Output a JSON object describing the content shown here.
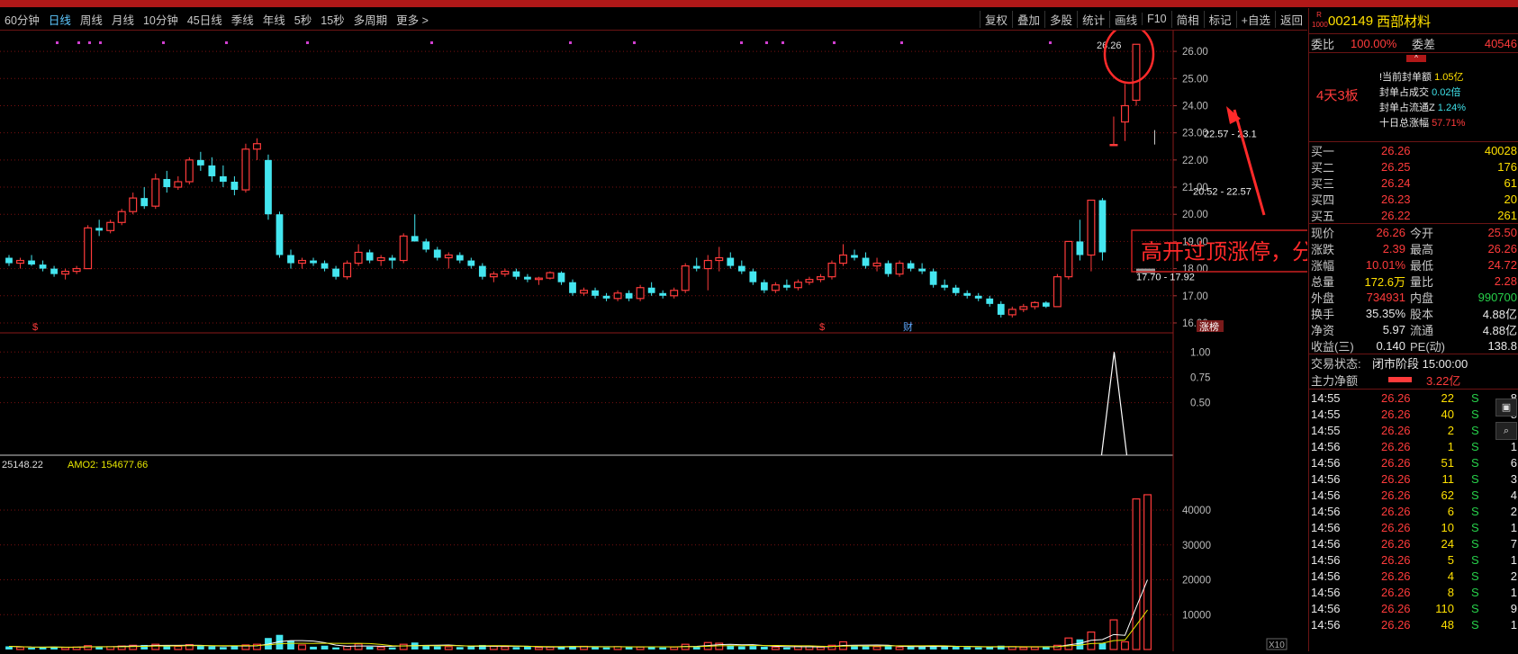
{
  "toolbar": {
    "periods": [
      "60分钟",
      "日线",
      "周线",
      "月线",
      "10分钟",
      "45日线",
      "季线",
      "年线",
      "5秒",
      "15秒",
      "多周期",
      "更多 >"
    ],
    "active_period": "日线",
    "buttons": [
      "复权",
      "叠加",
      "多股",
      "统计",
      "画线",
      "F10",
      "简相",
      "标记",
      "+自选",
      "返回"
    ]
  },
  "colors": {
    "up": "#ff3b3b",
    "down": "#44e6f0",
    "ma1": "#ffffff",
    "ma2": "#e6e600",
    "grid": "#7a1010",
    "accent": "#ffe000"
  },
  "chart": {
    "price_axis": [
      "26.00",
      "25.00",
      "24.00",
      "23.00",
      "22.00",
      "21.00",
      "20.00",
      "19.00",
      "18.00",
      "17.00",
      "16.00"
    ],
    "top_price_label": "26.26",
    "zone_labels": [
      "22.57 - 23.1",
      "20.52 - 22.57",
      "17.70 - 17.92"
    ],
    "annotation": "高开过顶涨停，分歧转一致",
    "event_marks": [
      "$",
      "$",
      "财",
      "涨榜"
    ],
    "indicator_axis": [
      "1.00",
      "0.75",
      "0.50"
    ],
    "vol_legend_prefix": "25148.22",
    "vol_legend_amo2": "AMO2: 154677.66",
    "vol_axis": [
      "40000",
      "30000",
      "20000",
      "10000"
    ],
    "vol_unit": "X10"
  },
  "chart_data": {
    "type": "candlestick",
    "ohlc": [
      [
        18.4,
        18.5,
        18.1,
        18.2
      ],
      [
        18.2,
        18.4,
        18.0,
        18.3
      ],
      [
        18.3,
        18.5,
        18.1,
        18.15
      ],
      [
        18.15,
        18.3,
        17.9,
        18.0
      ],
      [
        18.0,
        18.1,
        17.7,
        17.8
      ],
      [
        17.8,
        18.0,
        17.6,
        17.9
      ],
      [
        17.9,
        18.1,
        17.8,
        18.0
      ],
      [
        18.0,
        19.6,
        18.0,
        19.5
      ],
      [
        19.5,
        19.8,
        19.2,
        19.4
      ],
      [
        19.4,
        19.8,
        19.3,
        19.7
      ],
      [
        19.7,
        20.2,
        19.6,
        20.1
      ],
      [
        20.1,
        20.8,
        20.0,
        20.6
      ],
      [
        20.6,
        21.0,
        20.2,
        20.3
      ],
      [
        20.3,
        21.5,
        20.2,
        21.3
      ],
      [
        21.3,
        21.6,
        20.8,
        21.0
      ],
      [
        21.0,
        21.4,
        20.9,
        21.2
      ],
      [
        21.2,
        22.1,
        21.1,
        22.0
      ],
      [
        22.0,
        22.3,
        21.6,
        21.8
      ],
      [
        21.8,
        22.1,
        21.2,
        21.4
      ],
      [
        21.4,
        21.8,
        21.0,
        21.2
      ],
      [
        21.2,
        21.4,
        20.7,
        20.9
      ],
      [
        20.9,
        22.6,
        20.8,
        22.4
      ],
      [
        22.4,
        22.8,
        22.0,
        22.6
      ],
      [
        22.0,
        22.2,
        19.8,
        20.0
      ],
      [
        20.0,
        20.1,
        18.4,
        18.5
      ],
      [
        18.5,
        18.7,
        18.0,
        18.2
      ],
      [
        18.2,
        18.4,
        18.0,
        18.3
      ],
      [
        18.3,
        18.4,
        18.1,
        18.2
      ],
      [
        18.2,
        18.3,
        17.9,
        18.0
      ],
      [
        18.0,
        18.1,
        17.6,
        17.7
      ],
      [
        17.7,
        18.3,
        17.6,
        18.2
      ],
      [
        18.2,
        18.9,
        18.1,
        18.6
      ],
      [
        18.6,
        18.7,
        18.2,
        18.3
      ],
      [
        18.3,
        18.5,
        18.1,
        18.4
      ],
      [
        18.4,
        18.5,
        18.0,
        18.3
      ],
      [
        18.3,
        19.3,
        18.2,
        19.2
      ],
      [
        19.2,
        20.0,
        19.0,
        19.0
      ],
      [
        19.0,
        19.1,
        18.6,
        18.7
      ],
      [
        18.7,
        18.8,
        18.3,
        18.4
      ],
      [
        18.4,
        18.6,
        18.0,
        18.5
      ],
      [
        18.5,
        18.6,
        18.2,
        18.3
      ],
      [
        18.3,
        18.4,
        18.0,
        18.1
      ],
      [
        18.1,
        18.2,
        17.6,
        17.7
      ],
      [
        17.7,
        17.9,
        17.5,
        17.8
      ],
      [
        17.8,
        18.0,
        17.7,
        17.9
      ],
      [
        17.9,
        18.0,
        17.6,
        17.7
      ],
      [
        17.7,
        17.8,
        17.5,
        17.6
      ],
      [
        17.6,
        17.7,
        17.4,
        17.65
      ],
      [
        17.65,
        17.9,
        17.6,
        17.85
      ],
      [
        17.85,
        17.9,
        17.4,
        17.5
      ],
      [
        17.5,
        17.6,
        17.0,
        17.1
      ],
      [
        17.1,
        17.3,
        17.0,
        17.2
      ],
      [
        17.2,
        17.3,
        16.9,
        17.0
      ],
      [
        17.0,
        17.1,
        16.8,
        16.9
      ],
      [
        16.9,
        17.2,
        16.8,
        17.1
      ],
      [
        17.1,
        17.2,
        16.8,
        16.9
      ],
      [
        16.9,
        17.4,
        16.8,
        17.3
      ],
      [
        17.3,
        17.5,
        17.0,
        17.1
      ],
      [
        17.1,
        17.2,
        16.9,
        17.0
      ],
      [
        17.0,
        17.3,
        16.9,
        17.2
      ],
      [
        17.2,
        18.2,
        17.1,
        18.1
      ],
      [
        18.1,
        18.4,
        17.9,
        18.0
      ],
      [
        18.0,
        18.5,
        17.2,
        18.3
      ],
      [
        18.3,
        18.8,
        17.9,
        18.4
      ],
      [
        18.4,
        18.6,
        18.0,
        18.1
      ],
      [
        18.1,
        18.3,
        17.8,
        17.9
      ],
      [
        17.9,
        18.0,
        17.4,
        17.5
      ],
      [
        17.5,
        17.6,
        17.1,
        17.2
      ],
      [
        17.2,
        17.5,
        17.1,
        17.4
      ],
      [
        17.4,
        17.6,
        17.2,
        17.3
      ],
      [
        17.3,
        17.6,
        17.2,
        17.5
      ],
      [
        17.5,
        17.7,
        17.4,
        17.6
      ],
      [
        17.6,
        17.8,
        17.5,
        17.7
      ],
      [
        17.7,
        18.3,
        17.6,
        18.2
      ],
      [
        18.2,
        18.9,
        18.1,
        18.5
      ],
      [
        18.5,
        18.7,
        18.3,
        18.4
      ],
      [
        18.4,
        18.6,
        18.0,
        18.1
      ],
      [
        18.1,
        18.4,
        17.9,
        18.2
      ],
      [
        18.2,
        18.3,
        17.7,
        17.8
      ],
      [
        17.8,
        18.3,
        17.7,
        18.2
      ],
      [
        18.2,
        18.3,
        17.9,
        18.0
      ],
      [
        18.0,
        18.2,
        17.8,
        17.9
      ],
      [
        17.9,
        18.0,
        17.3,
        17.4
      ],
      [
        17.4,
        17.6,
        17.2,
        17.3
      ],
      [
        17.3,
        17.4,
        17.0,
        17.1
      ],
      [
        17.1,
        17.2,
        16.9,
        17.0
      ],
      [
        17.0,
        17.1,
        16.8,
        16.9
      ],
      [
        16.9,
        17.0,
        16.6,
        16.7
      ],
      [
        16.7,
        16.8,
        16.2,
        16.3
      ],
      [
        16.3,
        16.6,
        16.2,
        16.5
      ],
      [
        16.5,
        16.7,
        16.4,
        16.6
      ],
      [
        16.6,
        16.8,
        16.5,
        16.75
      ],
      [
        16.75,
        16.8,
        16.55,
        16.6
      ],
      [
        16.6,
        17.8,
        16.6,
        17.7
      ],
      [
        17.7,
        19.0,
        17.6,
        19.0
      ],
      [
        19.0,
        19.8,
        18.3,
        18.5
      ],
      [
        18.5,
        20.52,
        17.9,
        20.52
      ],
      [
        20.52,
        20.6,
        18.3,
        18.6
      ],
      [
        22.57,
        23.6,
        22.57,
        22.57
      ],
      [
        23.4,
        24.8,
        22.7,
        24.0
      ],
      [
        24.2,
        26.26,
        24.0,
        26.26
      ]
    ],
    "ylim": [
      15.9,
      26.5
    ],
    "indicator": {
      "values_tail": [
        0,
        0,
        0,
        0,
        0,
        1.0,
        0
      ],
      "ylim": [
        0,
        1.1
      ]
    },
    "volume_x10": [
      900,
      700,
      500,
      650,
      800,
      600,
      700,
      1100,
      900,
      800,
      1000,
      1200,
      1300,
      1500,
      1000,
      900,
      1400,
      1100,
      900,
      700,
      1000,
      1300,
      1500,
      3300,
      4200,
      2500,
      1300,
      800,
      1100,
      600,
      900,
      1600,
      800,
      700,
      600,
      1500,
      2000,
      1200,
      900,
      800,
      700,
      1000,
      1300,
      900,
      800,
      700,
      900,
      600,
      700,
      800,
      1000,
      900,
      700,
      600,
      800,
      900,
      700,
      800,
      600,
      700,
      1500,
      900,
      2000,
      1800,
      1200,
      900,
      1000,
      800,
      700,
      600,
      900,
      800,
      700,
      1200,
      2200,
      1300,
      900,
      800,
      1000,
      700,
      900,
      800,
      1100,
      900,
      800,
      700,
      600,
      700,
      1100,
      800,
      600,
      700,
      800,
      1200,
      3300,
      2900,
      5000,
      1800,
      8500,
      2200,
      43200,
      44400
    ],
    "volume_ylim": [
      0,
      48000
    ]
  },
  "panel": {
    "badge_top": "R",
    "badge_bottom": "1000",
    "code": "002149",
    "name": "西部材料",
    "weibi_label": "委比",
    "weibi_value": "100.00%",
    "weicha_label": "委差",
    "weicha_value": "40546",
    "seal_tag": "4天3板",
    "seal_rows": [
      {
        "label": "!当前封单额",
        "value": "1.05亿"
      },
      {
        "label": "封单占成交",
        "value": "0.02倍"
      },
      {
        "label": "封单占流通Z",
        "value": "1.24%"
      },
      {
        "label": "十日总涨幅",
        "value": "57.71%"
      }
    ],
    "book": [
      {
        "label": "买一",
        "price": "26.26",
        "vol": "40028"
      },
      {
        "label": "买二",
        "price": "26.25",
        "vol": "176"
      },
      {
        "label": "买三",
        "price": "26.24",
        "vol": "61"
      },
      {
        "label": "买四",
        "price": "26.23",
        "vol": "20"
      },
      {
        "label": "买五",
        "price": "26.22",
        "vol": "261"
      }
    ],
    "quote": [
      {
        "l1": "现价",
        "v1": "26.26",
        "l2": "今开",
        "v2": "25.50"
      },
      {
        "l1": "涨跌",
        "v1": "2.39",
        "l2": "最高",
        "v2": "26.26"
      },
      {
        "l1": "涨幅",
        "v1": "10.01%",
        "l2": "最低",
        "v2": "24.72"
      },
      {
        "l1": "总量",
        "v1": "172.6万",
        "l2": "量比",
        "v2": "2.28"
      },
      {
        "l1": "外盘",
        "v1": "734931",
        "l2": "内盘",
        "v2": "990700"
      },
      {
        "l1": "换手",
        "v1": "35.35%",
        "l2": "股本",
        "v2": "4.88亿"
      },
      {
        "l1": "净资",
        "v1": "5.97",
        "l2": "流通",
        "v2": "4.88亿"
      },
      {
        "l1": "收益(三)",
        "v1": "0.140",
        "l2": "PE(动)",
        "v2": "138.8"
      }
    ],
    "trade_status_label": "交易状态:",
    "trade_status_value": "闭市阶段 15:00:00",
    "main_net_label": "主力净额",
    "main_net_value": "3.22亿",
    "ticks": [
      {
        "t": "14:55",
        "p": "26.26",
        "v": "22",
        "s": "S",
        "n": "8"
      },
      {
        "t": "14:55",
        "p": "26.26",
        "v": "40",
        "s": "S",
        "n": "8"
      },
      {
        "t": "14:55",
        "p": "26.26",
        "v": "2",
        "s": "S",
        "n": "1"
      },
      {
        "t": "14:56",
        "p": "26.26",
        "v": "1",
        "s": "S",
        "n": "1"
      },
      {
        "t": "14:56",
        "p": "26.26",
        "v": "51",
        "s": "S",
        "n": "6"
      },
      {
        "t": "14:56",
        "p": "26.26",
        "v": "11",
        "s": "S",
        "n": "3"
      },
      {
        "t": "14:56",
        "p": "26.26",
        "v": "62",
        "s": "S",
        "n": "4"
      },
      {
        "t": "14:56",
        "p": "26.26",
        "v": "6",
        "s": "S",
        "n": "2"
      },
      {
        "t": "14:56",
        "p": "26.26",
        "v": "10",
        "s": "S",
        "n": "1"
      },
      {
        "t": "14:56",
        "p": "26.26",
        "v": "24",
        "s": "S",
        "n": "7"
      },
      {
        "t": "14:56",
        "p": "26.26",
        "v": "5",
        "s": "S",
        "n": "1"
      },
      {
        "t": "14:56",
        "p": "26.26",
        "v": "4",
        "s": "S",
        "n": "2"
      },
      {
        "t": "14:56",
        "p": "26.26",
        "v": "8",
        "s": "S",
        "n": "1"
      },
      {
        "t": "14:56",
        "p": "26.26",
        "v": "110",
        "s": "S",
        "n": "9"
      },
      {
        "t": "14:56",
        "p": "26.26",
        "v": "48",
        "s": "S",
        "n": "1"
      }
    ]
  }
}
